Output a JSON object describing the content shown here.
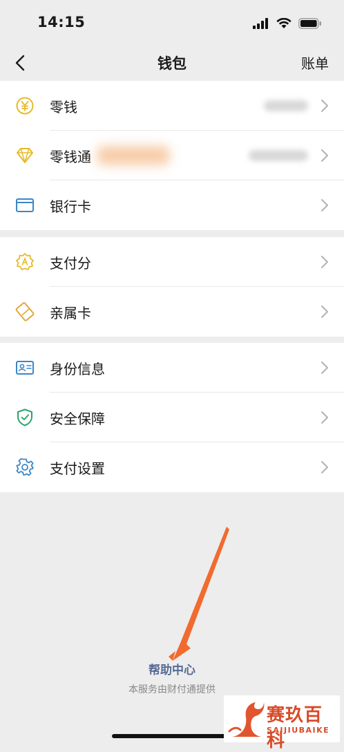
{
  "status_bar": {
    "time": "14:15"
  },
  "nav": {
    "title": "钱包",
    "right_label": "账单"
  },
  "groups": [
    {
      "items": [
        {
          "label": "零钱",
          "icon": "yuan-coin-icon"
        },
        {
          "label": "零钱通",
          "icon": "diamond-icon"
        },
        {
          "label": "银行卡",
          "icon": "bank-card-icon"
        }
      ]
    },
    {
      "items": [
        {
          "label": "支付分",
          "icon": "badge-score-icon"
        },
        {
          "label": "亲属卡",
          "icon": "family-card-icon"
        }
      ]
    },
    {
      "items": [
        {
          "label": "身份信息",
          "icon": "id-card-icon"
        },
        {
          "label": "安全保障",
          "icon": "shield-check-icon"
        },
        {
          "label": "支付设置",
          "icon": "gear-icon"
        }
      ]
    }
  ],
  "footer": {
    "help_link": "帮助中心",
    "provider_note": "本服务由财付通提供"
  },
  "watermark": {
    "name_cn": "赛玖百科",
    "name_en": "SAIJIUBAIKE"
  },
  "colors": {
    "yellow": "#e7b928",
    "blue": "#3a86c8",
    "green": "#2aa56b",
    "link": "#576b95",
    "arrow": "#f26a2e"
  }
}
